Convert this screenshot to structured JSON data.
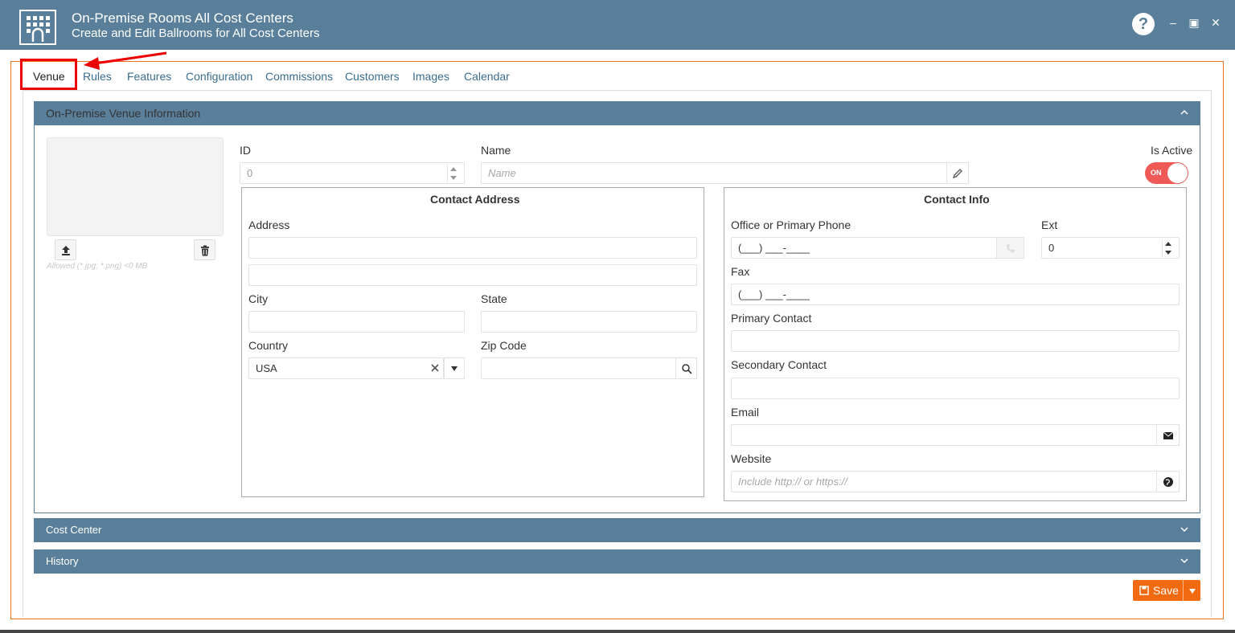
{
  "window": {
    "title": "On-Premise Rooms All Cost Centers",
    "subtitle": "Create and Edit Ballrooms for All Cost Centers",
    "help_label": "?",
    "minimize_label": "–",
    "maximize_label": "▣",
    "close_label": "✕"
  },
  "tabs": [
    {
      "label": "Venue",
      "active": true
    },
    {
      "label": "Rules"
    },
    {
      "label": "Features"
    },
    {
      "label": "Configuration"
    },
    {
      "label": "Commissions"
    },
    {
      "label": "Customers"
    },
    {
      "label": "Images"
    },
    {
      "label": "Calendar"
    }
  ],
  "venue_panel": {
    "title": "On-Premise Venue Information",
    "allowed_text": "Allowed (*.jpg; *.png) <0 MB",
    "id_label": "ID",
    "id_value": "0",
    "name_label": "Name",
    "name_placeholder": "Name",
    "is_active_label": "Is Active",
    "is_active_state": "ON"
  },
  "contact_address": {
    "title": "Contact Address",
    "address_label": "Address",
    "city_label": "City",
    "state_label": "State",
    "country_label": "Country",
    "country_value": "USA",
    "zip_label": "Zip Code"
  },
  "contact_info": {
    "title": "Contact Info",
    "phone_label": "Office or Primary Phone",
    "phone_value": "(___) ___-____",
    "ext_label": "Ext",
    "ext_value": "0",
    "fax_label": "Fax",
    "fax_value": "(___) ___-____",
    "primary_contact_label": "Primary Contact",
    "secondary_contact_label": "Secondary Contact",
    "email_label": "Email",
    "website_label": "Website",
    "website_placeholder": "Include http:// or https://"
  },
  "cost_center_panel": {
    "title": "Cost Center"
  },
  "history_panel": {
    "title": "History"
  },
  "save_button": {
    "label": "Save"
  },
  "colors": {
    "header": "#5a7f9a",
    "accent": "#f26a10",
    "toggle_on": "#f05a56",
    "highlight": "#ee0000"
  }
}
